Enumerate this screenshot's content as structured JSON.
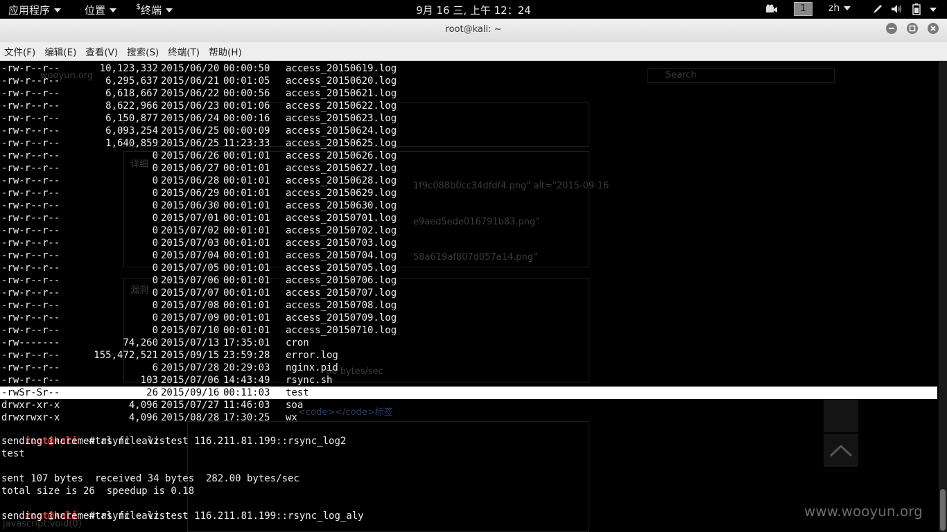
{
  "topbar": {
    "apps_menu": "应用程序",
    "places_menu": "位置",
    "terminal_menu_prefix": "$",
    "terminal_menu": "终端",
    "clock": "9月 16 三, 上午 12：24",
    "workspace": "1",
    "input_method": "zh",
    "icons": [
      "video-icon",
      "pen-icon",
      "volume-icon",
      "battery-icon",
      "chevron-down-icon"
    ]
  },
  "window": {
    "title": "root@kali: ~",
    "buttons": [
      "minimize-icon",
      "maximize-icon",
      "close-icon"
    ]
  },
  "menubar": {
    "items": [
      "文件(F)",
      "编辑(E)",
      "查看(V)",
      "搜索(S)",
      "终端(T)",
      "帮助(H)"
    ]
  },
  "terminal": {
    "listing": [
      {
        "perm": "-rw-r--r--",
        "size": "10,123,332",
        "date": "2015/06/20",
        "time": "00:00:50",
        "name": "access_20150619.log"
      },
      {
        "perm": "-rw-r--r--",
        "size": "6,295,637",
        "date": "2015/06/21",
        "time": "00:01:05",
        "name": "access_20150620.log"
      },
      {
        "perm": "-rw-r--r--",
        "size": "6,618,667",
        "date": "2015/06/22",
        "time": "00:00:56",
        "name": "access_20150621.log"
      },
      {
        "perm": "-rw-r--r--",
        "size": "8,622,966",
        "date": "2015/06/23",
        "time": "00:01:06",
        "name": "access_20150622.log"
      },
      {
        "perm": "-rw-r--r--",
        "size": "6,150,877",
        "date": "2015/06/24",
        "time": "00:00:16",
        "name": "access_20150623.log"
      },
      {
        "perm": "-rw-r--r--",
        "size": "6,093,254",
        "date": "2015/06/25",
        "time": "00:00:09",
        "name": "access_20150624.log"
      },
      {
        "perm": "-rw-r--r--",
        "size": "1,640,859",
        "date": "2015/06/25",
        "time": "11:23:33",
        "name": "access_20150625.log"
      },
      {
        "perm": "-rw-r--r--",
        "size": "0",
        "date": "2015/06/26",
        "time": "00:01:01",
        "name": "access_20150626.log"
      },
      {
        "perm": "-rw-r--r--",
        "size": "0",
        "date": "2015/06/27",
        "time": "00:01:01",
        "name": "access_20150627.log"
      },
      {
        "perm": "-rw-r--r--",
        "size": "0",
        "date": "2015/06/28",
        "time": "00:01:01",
        "name": "access_20150628.log"
      },
      {
        "perm": "-rw-r--r--",
        "size": "0",
        "date": "2015/06/29",
        "time": "00:01:01",
        "name": "access_20150629.log"
      },
      {
        "perm": "-rw-r--r--",
        "size": "0",
        "date": "2015/06/30",
        "time": "00:01:01",
        "name": "access_20150630.log"
      },
      {
        "perm": "-rw-r--r--",
        "size": "0",
        "date": "2015/07/01",
        "time": "00:01:01",
        "name": "access_20150701.log"
      },
      {
        "perm": "-rw-r--r--",
        "size": "0",
        "date": "2015/07/02",
        "time": "00:01:01",
        "name": "access_20150702.log"
      },
      {
        "perm": "-rw-r--r--",
        "size": "0",
        "date": "2015/07/03",
        "time": "00:01:01",
        "name": "access_20150703.log"
      },
      {
        "perm": "-rw-r--r--",
        "size": "0",
        "date": "2015/07/04",
        "time": "00:01:01",
        "name": "access_20150704.log"
      },
      {
        "perm": "-rw-r--r--",
        "size": "0",
        "date": "2015/07/05",
        "time": "00:01:01",
        "name": "access_20150705.log"
      },
      {
        "perm": "-rw-r--r--",
        "size": "0",
        "date": "2015/07/06",
        "time": "00:01:01",
        "name": "access_20150706.log"
      },
      {
        "perm": "-rw-r--r--",
        "size": "0",
        "date": "2015/07/07",
        "time": "00:01:01",
        "name": "access_20150707.log"
      },
      {
        "perm": "-rw-r--r--",
        "size": "0",
        "date": "2015/07/08",
        "time": "00:01:01",
        "name": "access_20150708.log"
      },
      {
        "perm": "-rw-r--r--",
        "size": "0",
        "date": "2015/07/09",
        "time": "00:01:01",
        "name": "access_20150709.log"
      },
      {
        "perm": "-rw-r--r--",
        "size": "0",
        "date": "2015/07/10",
        "time": "00:01:01",
        "name": "access_20150710.log"
      },
      {
        "perm": "-rw-------",
        "size": "74,260",
        "date": "2015/07/13",
        "time": "17:35:01",
        "name": "cron"
      },
      {
        "perm": "-rw-r--r--",
        "size": "155,472,521",
        "date": "2015/09/15",
        "time": "23:59:28",
        "name": "error.log"
      },
      {
        "perm": "-rw-r--r--",
        "size": "6",
        "date": "2015/07/28",
        "time": "20:29:03",
        "name": "nginx.pid"
      },
      {
        "perm": "-rw-r--r--",
        "size": "103",
        "date": "2015/07/06",
        "time": "14:43:49",
        "name": "rsync.sh"
      },
      {
        "perm": "-rwSr-Sr--",
        "size": "26",
        "date": "2015/09/16",
        "time": "00:11:03",
        "name": "test"
      },
      {
        "perm": "drwxr-xr-x",
        "size": "4,096",
        "date": "2015/07/27",
        "time": "11:46:03",
        "name": "soa"
      },
      {
        "perm": "drwxrwxr-x",
        "size": "4,096",
        "date": "2015/08/28",
        "time": "17:30:25",
        "name": "wx"
      }
    ],
    "highlighted_row": 26,
    "prompt_user": "root@kali",
    "prompt_path": ":~",
    "prompt_symbol": "# ",
    "cmd1": "rsync -avz test 116.211.81.199::rsync_log2",
    "out1": "sending incremental file list",
    "out2": "test",
    "out3": "sent 107 bytes  received 34 bytes  282.00 bytes/sec",
    "out4": "total size is 26  speedup is 0.18",
    "cmd2": "rsync -avz test 116.211.81.199::rsync_log_aly",
    "out5": "sending incremental file list"
  },
  "background_window": {
    "url_text": "wooyun.org",
    "search_placeholder": "Search",
    "label_detail": "详细",
    "label_vuln": "漏洞",
    "png1": "1f9c088b0cc34dfdf4.png\" alt=\"2015-09-16",
    "png2": "e9aed5ede016791b83.png\"",
    "png3": "58a619af807d057a14.png\"",
    "bytes_sec": "00 bytes/sec",
    "code_tag": "<code></code>标签",
    "status": "javascript:void(0)"
  },
  "watermark": "www.wooyun.org",
  "colors": {
    "prompt_red": "#e33b3b",
    "path_blue": "#7aa0ff",
    "highlight_bg": "#ffffff"
  }
}
